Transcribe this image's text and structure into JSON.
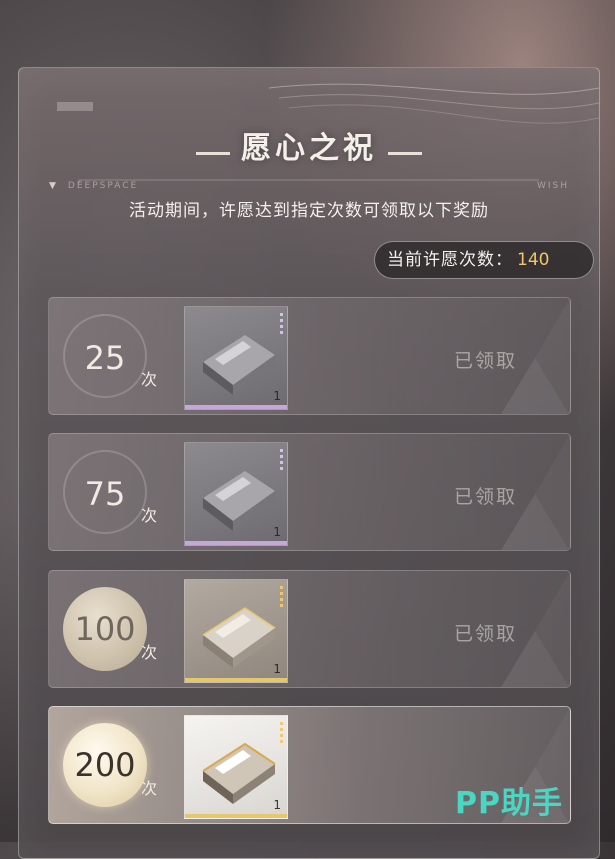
{
  "header": {
    "title": "愿心之祝",
    "deco_left": "DEEPSPACE",
    "deco_right": "WISH",
    "subtitle": "活动期间，许愿达到指定次数可领取以下奖励"
  },
  "wish_count": {
    "label": "当前许愿次数：",
    "value": "140"
  },
  "milestones": [
    {
      "count": "25",
      "unit": "次",
      "item_qty": "1",
      "status": "已领取"
    },
    {
      "count": "75",
      "unit": "次",
      "item_qty": "1",
      "status": "已领取"
    },
    {
      "count": "100",
      "unit": "次",
      "item_qty": "1",
      "status": "已领取"
    },
    {
      "count": "200",
      "unit": "次",
      "item_qty": "1",
      "status": ""
    }
  ],
  "watermark": "PP助手",
  "colors": {
    "accent_count": "#f2c46b",
    "watermark": "#49d7c4",
    "rarity_purple": "#c7a7d8",
    "rarity_gold": "#e8c66a"
  }
}
